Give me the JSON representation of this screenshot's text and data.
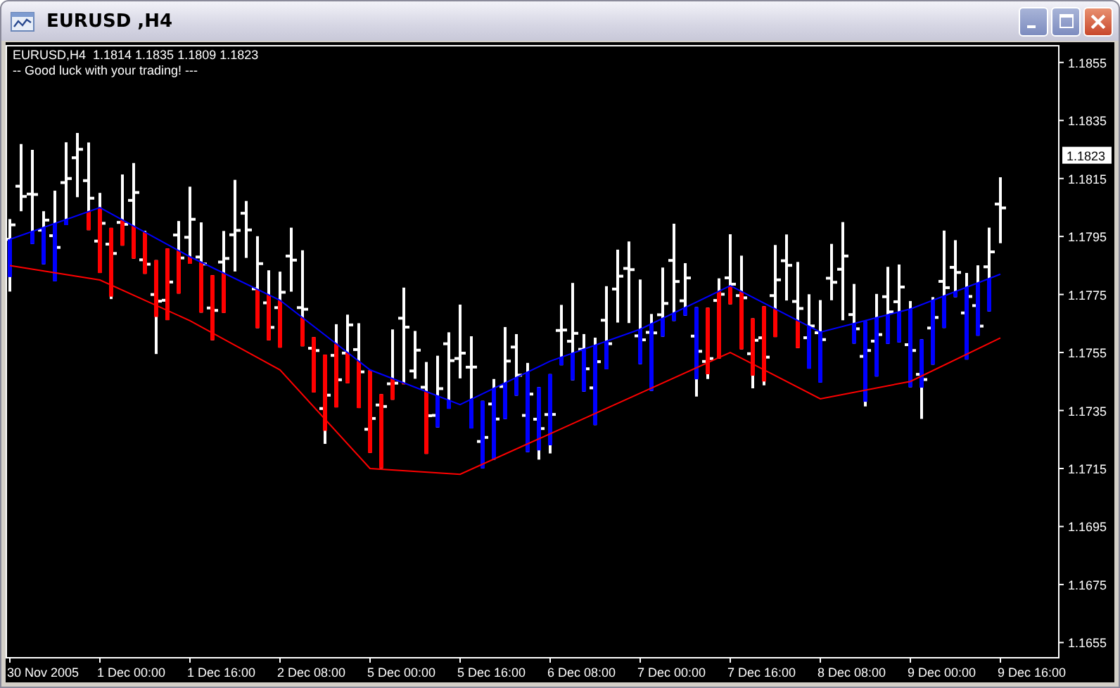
{
  "window": {
    "title": "EURUSD ,H4"
  },
  "chart": {
    "header": "EURUSD,H4  1.1814 1.1835 1.1809 1.1823",
    "comment": "-- Good luck with your trading! ---",
    "price_label": "1.1823",
    "chart_data": {
      "type": "line",
      "categories": [
        "30 Nov 2005",
        "1 Dec 00:00",
        "1 Dec 16:00",
        "2 Dec 08:00",
        "5 Dec 00:00",
        "5 Dec 16:00",
        "6 Dec 08:00",
        "7 Dec 00:00",
        "7 Dec 16:00",
        "8 Dec 08:00",
        "9 Dec 00:00",
        "9 Dec 16:00"
      ],
      "ylim": [
        1.165,
        1.1861
      ],
      "yticks": [
        1.1655,
        1.1675,
        1.1695,
        1.1715,
        1.1735,
        1.1755,
        1.1775,
        1.1795,
        1.1815,
        1.1835,
        1.1855
      ],
      "series": [
        {
          "color": "#0000ff",
          "values": [
            1.1794,
            1.1805,
            1.1788,
            1.1773,
            1.1749,
            1.1737,
            1.1752,
            1.1763,
            1.1778,
            1.1762,
            1.177,
            1.1782
          ]
        },
        {
          "color": "#ff0000",
          "values": [
            1.1785,
            1.178,
            1.1766,
            1.1749,
            1.1715,
            1.1713,
            1.1727,
            1.1741,
            1.1755,
            1.1739,
            1.1745,
            1.176
          ]
        }
      ]
    }
  }
}
